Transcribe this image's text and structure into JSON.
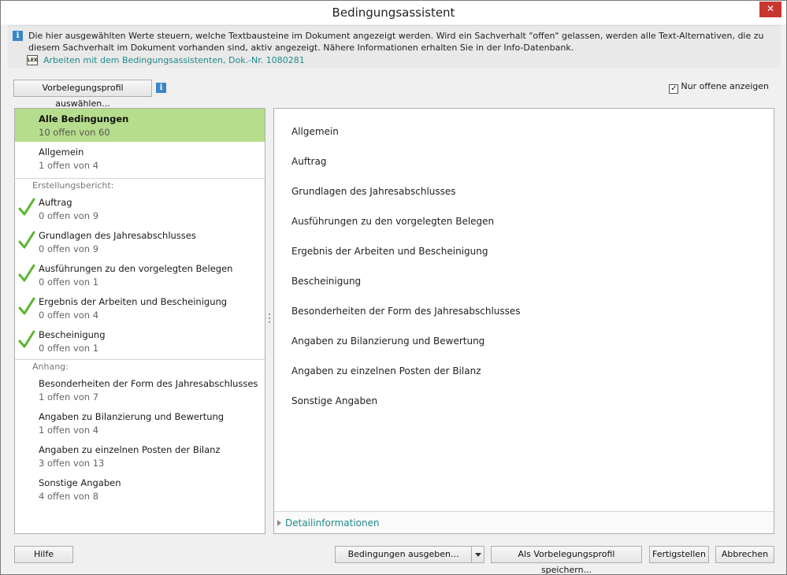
{
  "window": {
    "title": "Bedingungsassistent",
    "close_label": "✕"
  },
  "infobar": {
    "text": "Die hier ausgewählten Werte steuern, welche Textbausteine im Dokument angezeigt werden. Wird ein Sachverhalt \"offen\" gelassen, werden alle Text-Alternativen, die zu diesem Sachverhalt im Dokument vorhanden sind, aktiv angezeigt. Nähere Informationen erhalten Sie in der Info-Datenbank.",
    "lex_icon_label": "LEX",
    "link": "Arbeiten mit dem Bedingungsassistenten, Dok.-Nr. 1080281"
  },
  "toolbar": {
    "profile_button": "Vorbelegungsprofil auswählen...",
    "only_open_label": "Nur offene anzeigen",
    "only_open_checked": true,
    "check_glyph": "✓"
  },
  "left_list": {
    "top": [
      {
        "title": "Alle Bedingungen",
        "status": "10 offen von 60",
        "selected": true
      },
      {
        "title": "Allgemein",
        "status": "1 offen von 4"
      }
    ],
    "section1": "Erstellungsbericht:",
    "group1": [
      {
        "title": "Auftrag",
        "status": "0 offen von 9",
        "done": true
      },
      {
        "title": "Grundlagen des Jahresabschlusses",
        "status": "0 offen von 9",
        "done": true
      },
      {
        "title": "Ausführungen zu den vorgelegten Belegen",
        "status": "0 offen von 1",
        "done": true
      },
      {
        "title": "Ergebnis der Arbeiten und Bescheinigung",
        "status": "0 offen von 4",
        "done": true
      },
      {
        "title": "Bescheinigung",
        "status": "0 offen von 1",
        "done": true
      }
    ],
    "section2": "Anhang:",
    "group2": [
      {
        "title": "Besonderheiten der Form des Jahresabschlusses",
        "status": "1 offen von 7"
      },
      {
        "title": "Angaben zu Bilanzierung und Bewertung",
        "status": "1 offen von 4"
      },
      {
        "title": "Angaben zu einzelnen Posten der Bilanz",
        "status": "3 offen von 13"
      },
      {
        "title": "Sonstige Angaben",
        "status": "4 offen von 8"
      }
    ]
  },
  "right_list": {
    "items": [
      "Allgemein",
      "Auftrag",
      "Grundlagen des Jahresabschlusses",
      "Ausführungen zu den vorgelegten Belegen",
      "Ergebnis der Arbeiten und Bescheinigung",
      "Bescheinigung",
      "Besonderheiten der Form des Jahresabschlusses",
      "Angaben zu Bilanzierung und Bewertung",
      "Angaben zu einzelnen Posten der Bilanz",
      "Sonstige Angaben"
    ],
    "detail_label": "Detailinformationen"
  },
  "footer": {
    "help": "Hilfe",
    "output": "Bedingungen ausgeben...",
    "save_profile": "Als Vorbelegungsprofil speichern...",
    "finish": "Fertigstellen",
    "cancel": "Abbrechen"
  },
  "colors": {
    "selected": "#b6dd8d",
    "link": "#1f8a8a",
    "check": "#5bb531",
    "close": "#c7372f"
  }
}
